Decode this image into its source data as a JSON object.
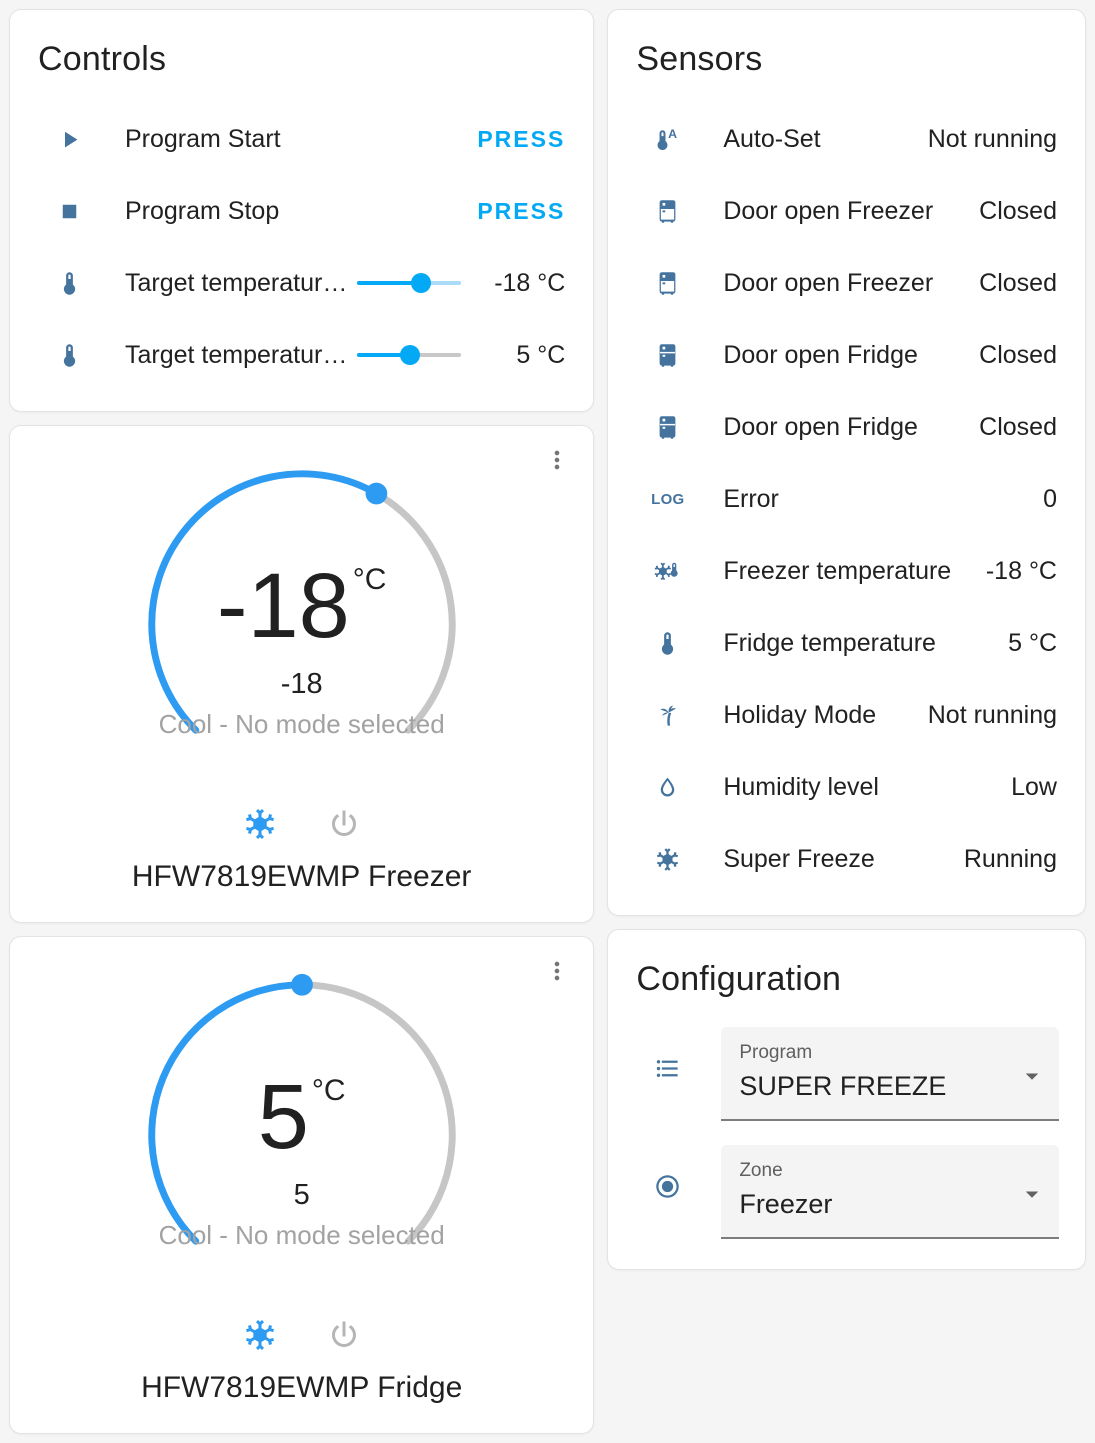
{
  "colors": {
    "icon_blue": "#44739e",
    "accent_blue": "#03a9f4",
    "dial_blue": "#2e9bf2",
    "dial_gray": "#c6c6c6",
    "status_gray": "#a2a2a2"
  },
  "controls_card": {
    "title": "Controls",
    "rows": [
      {
        "icon": "play-icon",
        "name": "Program Start",
        "type": "press",
        "action": "PRESS"
      },
      {
        "icon": "stop-icon",
        "name": "Program Stop",
        "type": "press",
        "action": "PRESS"
      },
      {
        "icon": "thermometer-icon",
        "name": "Target temperatur…",
        "type": "slider",
        "value": "-18 °C",
        "fraction": 0.61,
        "track_inactive": "#aadcf7"
      },
      {
        "icon": "thermometer-icon",
        "name": "Target temperatur…",
        "type": "slider",
        "value": "5 °C",
        "fraction": 0.51,
        "track_inactive": "#c8c8c8"
      }
    ]
  },
  "freezer_card": {
    "temperature": "-18",
    "unit": "°C",
    "secondary": "-18",
    "status": "Cool - No mode selected",
    "dial_fraction": 0.61,
    "name": "HFW7819EWMP Freezer"
  },
  "fridge_card": {
    "temperature": "5",
    "unit": "°C",
    "secondary": "5",
    "status": "Cool - No mode selected",
    "dial_fraction": 0.5,
    "name": "HFW7819EWMP Fridge"
  },
  "sensors_card": {
    "title": "Sensors",
    "rows": [
      {
        "icon": "thermometer-auto-icon",
        "name": "Auto-Set",
        "value": "Not running"
      },
      {
        "icon": "fridge-freezer-icon",
        "name": "Door open Freezer",
        "value": "Closed"
      },
      {
        "icon": "fridge-freezer-icon",
        "name": "Door open Freezer",
        "value": "Closed"
      },
      {
        "icon": "fridge-icon",
        "name": "Door open Fridge",
        "value": "Closed"
      },
      {
        "icon": "fridge-icon",
        "name": "Door open Fridge",
        "value": "Closed"
      },
      {
        "icon": "log-icon",
        "name": "Error",
        "value": "0"
      },
      {
        "icon": "snowflake-thermometer-icon",
        "name": "Freezer temperature",
        "value": "-18 °C"
      },
      {
        "icon": "thermometer-icon",
        "name": "Fridge temperature",
        "value": "5 °C"
      },
      {
        "icon": "palm-tree-icon",
        "name": "Holiday Mode",
        "value": "Not running"
      },
      {
        "icon": "water-drop-icon",
        "name": "Humidity level",
        "value": "Low"
      },
      {
        "icon": "snowflake-icon",
        "name": "Super Freeze",
        "value": "Running"
      }
    ],
    "log_icon_text": "LOG"
  },
  "config_card": {
    "title": "Configuration",
    "fields": [
      {
        "icon": "list-icon",
        "label": "Program",
        "value": "SUPER FREEZE"
      },
      {
        "icon": "radiobox-icon",
        "label": "Zone",
        "value": "Freezer"
      }
    ]
  }
}
